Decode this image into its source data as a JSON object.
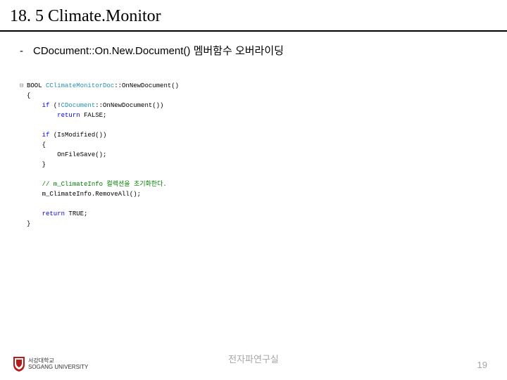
{
  "title": "18. 5 Climate.Monitor",
  "bullet": {
    "dash": "-",
    "text": "CDocument::On.New.Document() 멤버함수 오버라이딩"
  },
  "code": {
    "line1_pre": "BOOL ",
    "line1_cls": "CClimateMonitorDoc",
    "line1_post": "::OnNewDocument()",
    "line2": "{",
    "line3_pre": "    ",
    "line3_kw": "if",
    "line3_post": " (!",
    "line3_cls": "CDocument",
    "line3_post2": "::OnNewDocument())",
    "line4_pre": "        ",
    "line4_kw": "return",
    "line4_post": " FALSE;",
    "line5": "",
    "line6_pre": "    ",
    "line6_kw": "if",
    "line6_post": " (IsModified())",
    "line7": "    {",
    "line8": "        OnFileSave();",
    "line9": "    }",
    "line10": "",
    "line11_pre": "    ",
    "line11_cmt": "// m_ClimateInfo 컬렉션을 초기화한다.",
    "line12": "    m_ClimateInfo.RemoveAll();",
    "line13": "",
    "line14_pre": "    ",
    "line14_kw": "return",
    "line14_post": " TRUE;",
    "line15": "}"
  },
  "footer": {
    "center": "전자파연구실",
    "page": "19",
    "logo_kor": "서강대학교",
    "logo_eng": "SOGANG UNIVERSITY"
  }
}
